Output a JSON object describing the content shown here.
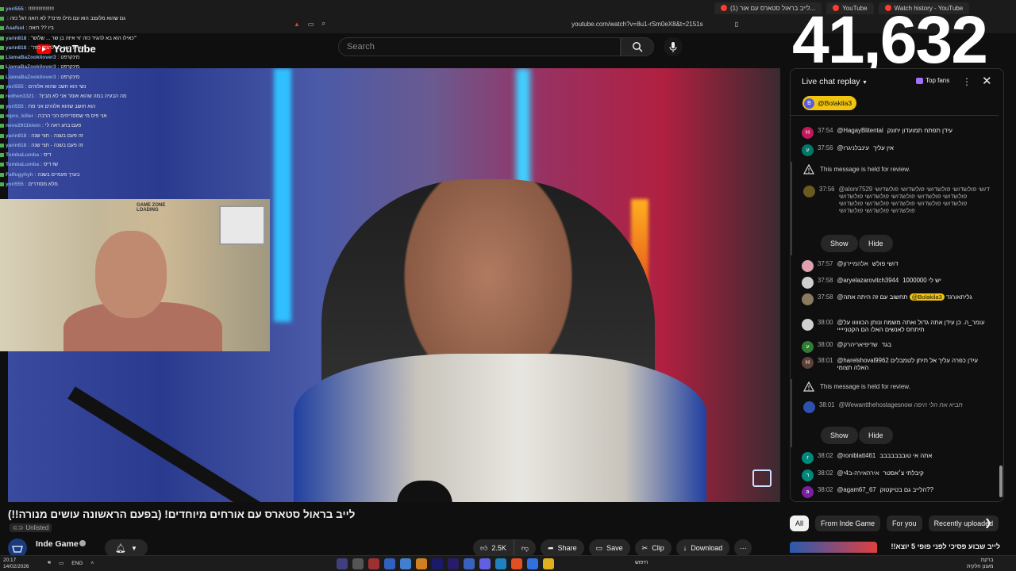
{
  "browser": {
    "tabs": [
      {
        "label": "(1) לייב בראול סטארס עם אור..."
      },
      {
        "label": "YouTube"
      },
      {
        "label": "Watch history - YouTube"
      }
    ],
    "url": "youtube.com/watch?v=8u1-rSm0eX8&t=2151s"
  },
  "yt": {
    "logo_text": "YouTube",
    "search_placeholder": "Search"
  },
  "overlay": {
    "viewer_count": "41,632",
    "webcam_sign": "GAME ZONE",
    "webcam_sign2": "LOADING",
    "stream_chat": [
      {
        "name": "yori555",
        "text": "!!!!!!!!!!!!!!!!!!"
      },
      {
        "name": "",
        "text": "גם שהוא מלעצב הוא עם מילו פרנד? לא רואה דגל כזה"
      },
      {
        "name": "Asafsol",
        "text": "ביו ?? רואה"
      },
      {
        "name": "yarin818",
        "text": "\"כאילו הוא בא להגיד כזה 'ווי איזה בן שר ... שלוש'\""
      },
      {
        "name": "yarin818",
        "text": "\"כאילו הוא בא להגיד כזה\""
      },
      {
        "name": "LlamaBaZookilover3",
        "text": "מינקרפט"
      },
      {
        "name": "LlamaBaZookilover3",
        "text": "מינקרפט"
      },
      {
        "name": "LlamaBaZookilover3",
        "text": "מינקרפט"
      },
      {
        "name": "yori555",
        "text": "נשי הוא חשב שהוא אלוהים"
      },
      {
        "name": "redhen3321",
        "text": "?מה הבעיה במה שהוא אומר אני לא מבין"
      },
      {
        "name": "yori555",
        "text": "הוא חושב שהוא אלוהים אני מת"
      },
      {
        "name": "mpro_killer",
        "text": "אני פיס מי שמסריחים הכי הרבה"
      },
      {
        "name": "nevo2911klein",
        "text": "פעם בחג ראה לי"
      },
      {
        "name": "yarin818",
        "text": "זה פעם בשנה - חצי שנה"
      },
      {
        "name": "yarin818",
        "text": "זה פעם בשנה - חצי שנה"
      },
      {
        "name": "TumbaLumba",
        "text": "דיס"
      },
      {
        "name": "TumbaLumba",
        "text": "שז דיס"
      },
      {
        "name": "Falfugyhyh",
        "text": "בערך פעמיים בשנה"
      },
      {
        "name": "yori555",
        "text": "מלא מסודרים"
      }
    ]
  },
  "video": {
    "title": "לייב בראול סטארס עם אורחים מיוחדים! (בפעם הראשונה עושים מנורה!!)",
    "visibility": "Unlisted",
    "channel_name": "Inde Game",
    "likes": "2.5K",
    "actions": {
      "share": "Share",
      "save": "Save",
      "clip": "Clip",
      "download": "Download"
    }
  },
  "chat": {
    "header": "Live chat replay",
    "top_fans": "Top fans",
    "pinned_user": "@Bolakila3",
    "pinned_initial": "B",
    "messages_top": [
      {
        "time": "37:54",
        "author": "@HagayBlitental",
        "text": "עידן תפתח תמועדון יחונק",
        "initial": "H",
        "color": "#c2185b"
      },
      {
        "time": "37:56",
        "author": "@עינבלניגרו",
        "text": "אין עליך",
        "initial": "ע",
        "color": "#00796b"
      }
    ],
    "held_label": "This message is held for review.",
    "held1": {
      "time": "37:56",
      "author": "@alonr7529",
      "text": "דושי פולשדושי פולשדושי פולשדושי פולשדושי פולשדושי פולשדושי פולשדושי פולשדושי פולשדושי פולשדושי פולשדושי פולשדושי פולשדושי פולשדושי פולשדושי פולשדושי פולשדושי"
    },
    "show_label": "Show",
    "hide_label": "Hide",
    "messages_mid": [
      {
        "time": "37:57",
        "author": "@אלהמיירון",
        "text": "דושי פולש",
        "initial": "",
        "color": "#e0a0b0"
      },
      {
        "time": "37:58",
        "author": "@aryelazarovitch3944",
        "text": "יש לי 1000000",
        "initial": "",
        "color": "#cfcfcf"
      },
      {
        "time": "37:58",
        "author": "@גליתאורגד",
        "text": "תחשוב עם זה",
        "chip": "@Bolakila3",
        "text2": "היתה אתה",
        "initial": "",
        "color": "#8a7a60"
      },
      {
        "time": "38:00",
        "author": "@עומר_ה.",
        "text": "כן עידן אתה גדול ואתה משמח ונותן הכוווווו על תיתחס לאנשים האלו הם הקטנייייי",
        "initial": "",
        "color": "#d0d0d0"
      },
      {
        "time": "38:00",
        "author": "@שדיפיאריהרק",
        "text": "בגד",
        "initial": "ע",
        "color": "#2e7d32"
      },
      {
        "time": "38:01",
        "author": "@harelshoval9962",
        "text": "עידן כפרה עליך אל תיתן לטמבלים האלה תצומי",
        "initial": "H",
        "color": "#5d4037"
      }
    ],
    "held2": {
      "time": "38:01",
      "author": "@Wewantthehostagesnow",
      "text": "תביא את הלי היפה"
    },
    "messages_bottom": [
      {
        "time": "38:02",
        "author": "@roniblatt461",
        "text": "אתה אי טובבבבבבב",
        "initial": "r",
        "color": "#00897b"
      },
      {
        "time": "38:02",
        "author": "@אירהאירה-ב4י",
        "text": "קיבלתי צ׳אסטר",
        "initial": "ר",
        "color": "#00897b"
      },
      {
        "time": "38:02",
        "author": "@agam67_67",
        "text": "הלייב גם בטיקטוק??",
        "initial": "a",
        "color": "#7b1fa2"
      }
    ]
  },
  "filters": [
    "All",
    "From Inde Game",
    "For you",
    "Recently uploaded"
  ],
  "recommendation": {
    "title": "לייב שבוע פסיכי לפני פופי 5 יוצא!!"
  },
  "taskbar": {
    "time": "20:17",
    "date": "14/02/2026",
    "lang": "ENG",
    "search": "חיפוש",
    "right_top": "ברקת",
    "right_bottom": "מעונן חלקית"
  }
}
